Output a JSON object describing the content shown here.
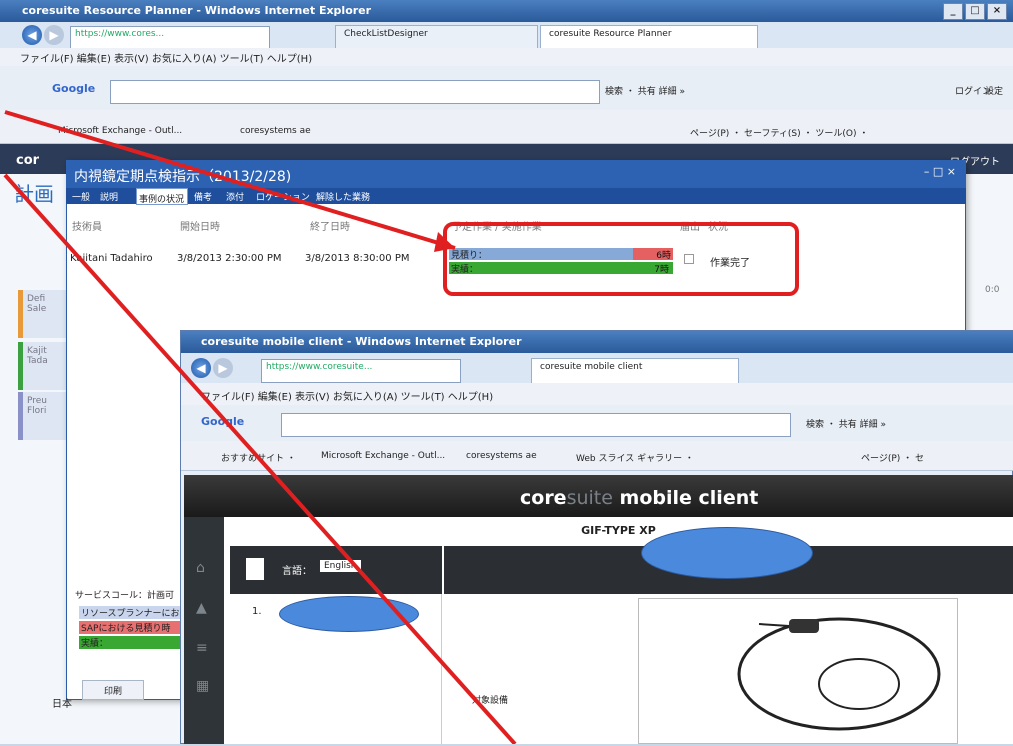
{
  "ie_outer": {
    "title": "coresuite Resource Planner - Windows Internet Explorer",
    "address": "https://www.cores...",
    "tabs": [
      "CheckListDesigner",
      "coresuite Resource Planner"
    ],
    "menu": "ファイル(F)  編集(E)  表示(V)  お気に入り(A)  ツール(T)  ヘルプ(H)",
    "google_label": "Google",
    "google_tools": "検索 ・  共有  詳細 »",
    "login": "ログイン",
    "settings": "設定",
    "fav_exchange": "Microsoft Exchange - Outl...",
    "fav_coresys": "coresystems ae",
    "page_tools": "ページ(P) ・ セーフティ(S) ・ ツール(O) ・"
  },
  "app": {
    "brand": "cor",
    "side_title": "計画",
    "side_cards": [
      "Defi Sale",
      "Kajit Tada",
      "Preu Flori"
    ],
    "logout": "ログアウト",
    "right_label": "0:0"
  },
  "dialog": {
    "title": "内視鏡定期点検指示（2013/2/28)",
    "toolbar": [
      "一般",
      "説明",
      "事例の状況",
      "備考",
      "添付",
      "ロケーション",
      "解除した業務"
    ],
    "columns": [
      "技術員",
      "開始日時",
      "終了日時",
      "予定作業 / 実施作業",
      "届出",
      "状況"
    ],
    "row": {
      "tech": "Kajitani Tadahiro",
      "start": "3/8/2013 2:30:00 PM",
      "end": "3/8/2013 8:30:00 PM",
      "plan_label": "見積り：",
      "plan_value": "6時",
      "actual_label": "実績：",
      "actual_value": "7時",
      "status": "作業完了"
    },
    "legend_title": "サービスコール：計画可",
    "legend": [
      "リソースプランナーにお",
      "SAPにおける見積り時",
      "実績："
    ],
    "lang": "日本",
    "print_label": "印刷"
  },
  "ie_mobile": {
    "title": "coresuite mobile client - Windows Internet Explorer",
    "address": "https://www.coresuite...",
    "tab": "coresuite mobile client",
    "menu": "ファイル(F)  編集(E)  表示(V)  お気に入り(A)  ツール(T)  ヘルプ(H)",
    "google_label": "Google",
    "google_tools": "検索 ・  共有  詳細 »",
    "fav_suggest": "おすすめサイト ・",
    "fav_exchange": "Microsoft Exchange - Outl...",
    "fav_coresys": "coresystems ae",
    "fav_slice": "Web スライス ギャラリー ・",
    "page_tools": "ページ(P) ・ セ"
  },
  "mobile_client": {
    "brand_core": "core",
    "brand_suite": "suite",
    "brand_rest": " mobile client",
    "panel_title": "GIF-TYPE XP",
    "lang_label": "言語：",
    "lang_value": "English",
    "tree_item": "1.",
    "field_label": "対象設備"
  },
  "colors": {
    "accent": "#2d62b3",
    "annotation_red": "#e02020",
    "plan_bar": "#87a9d8",
    "actual_bar": "#39a832",
    "ellipse": "#4a89dc"
  }
}
